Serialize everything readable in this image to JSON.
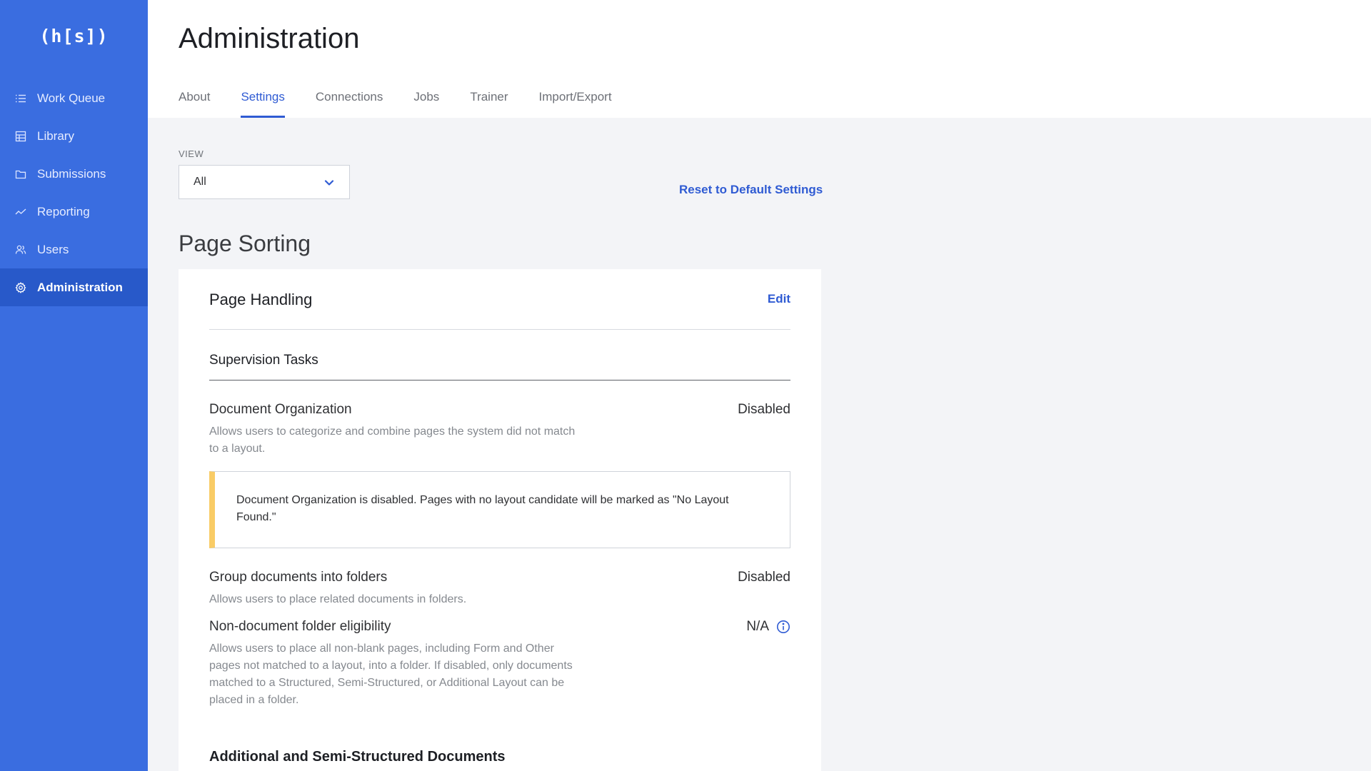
{
  "sidebar": {
    "logo": "(h[s])",
    "items": [
      {
        "label": "Work Queue",
        "icon": "list-icon"
      },
      {
        "label": "Library",
        "icon": "table-icon"
      },
      {
        "label": "Submissions",
        "icon": "folder-icon"
      },
      {
        "label": "Reporting",
        "icon": "trend-icon"
      },
      {
        "label": "Users",
        "icon": "users-icon"
      },
      {
        "label": "Administration",
        "icon": "gear-icon",
        "active": true
      }
    ]
  },
  "header": {
    "title": "Administration",
    "tabs": [
      "About",
      "Settings",
      "Connections",
      "Jobs",
      "Trainer",
      "Import/Export"
    ],
    "active_tab": "Settings"
  },
  "view": {
    "label": "VIEW",
    "selected": "All"
  },
  "reset_label": "Reset to Default Settings",
  "section_title": "Page Sorting",
  "card": {
    "title": "Page Handling",
    "edit_label": "Edit",
    "subhead": "Supervision Tasks",
    "settings": [
      {
        "name": "Document Organization",
        "description": "Allows users to categorize and combine pages the system did not match to a layout.",
        "value": "Disabled"
      },
      {
        "name": "Group documents into folders",
        "description": "Allows users to place related documents in folders.",
        "value": "Disabled"
      },
      {
        "name": "Non-document folder eligibility",
        "description": "Allows users to place all non-blank pages, including Form and Other pages not matched to a layout, into a folder. If disabled, only documents matched to a Structured, Semi-Structured, or Additional Layout can be placed in a folder.",
        "value": "N/A"
      }
    ],
    "alert": "Document Organization is disabled. Pages with no layout candidate will be marked as \"No Layout Found.\"",
    "next_section": "Additional and Semi-Structured Documents"
  },
  "colors": {
    "sidebar": "#3a6de0",
    "sidebar_active": "#2859c9",
    "accent": "#2f5bd3",
    "alert_border": "#f9cc66"
  }
}
